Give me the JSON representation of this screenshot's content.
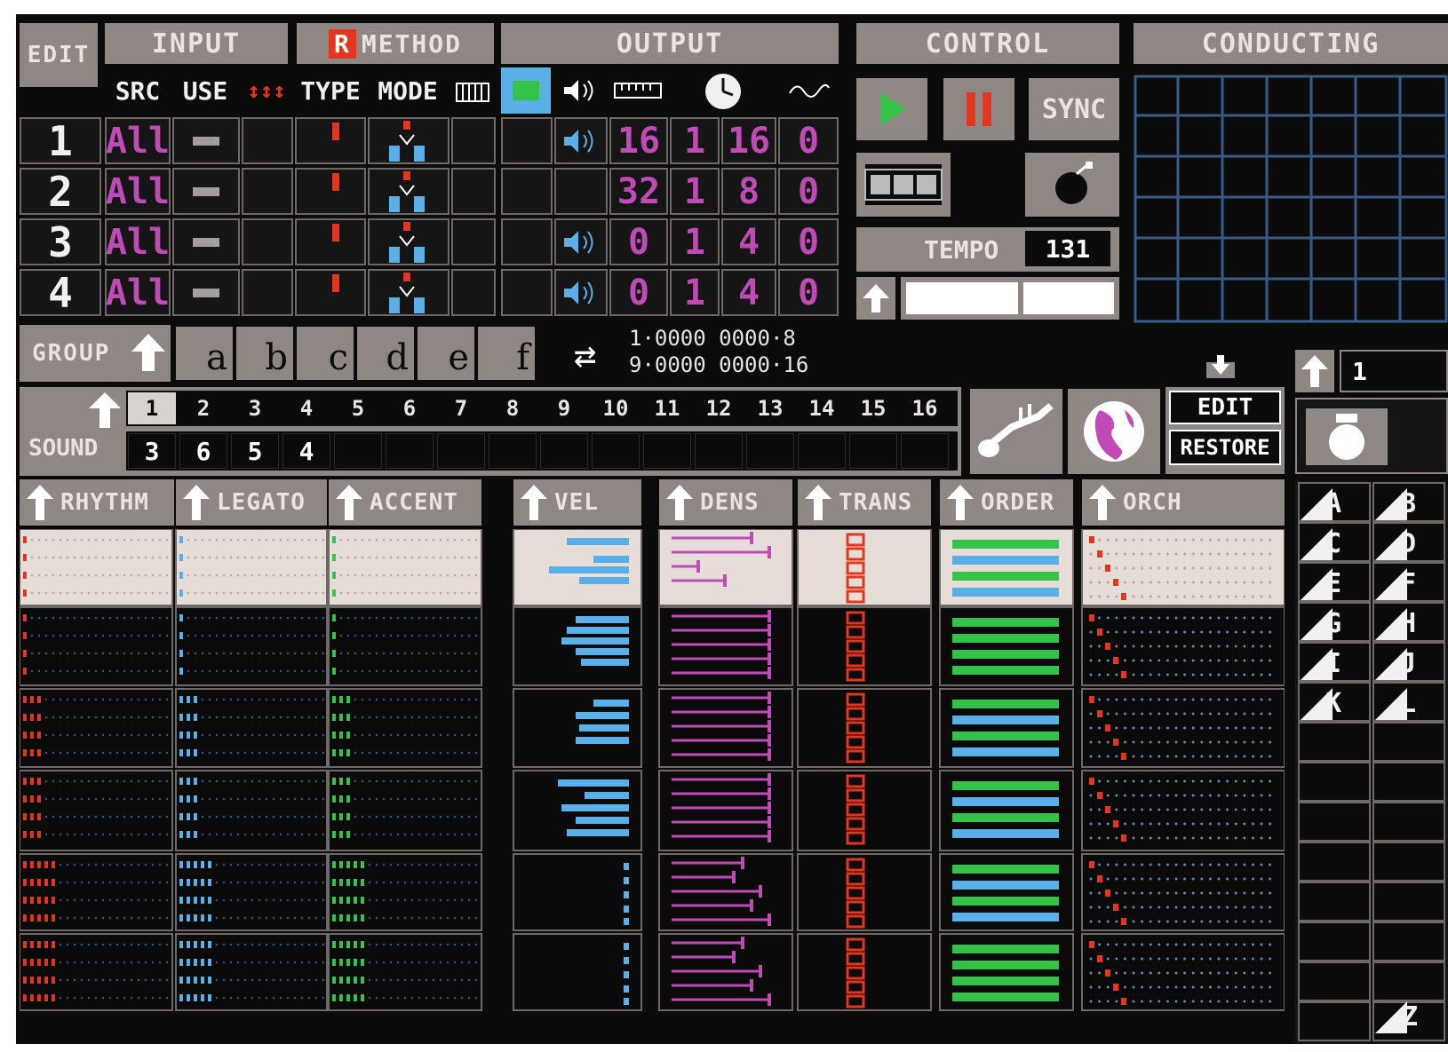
{
  "header": {
    "edit": "EDIT",
    "input": "INPUT",
    "method_badge": "R",
    "method": "METHOD",
    "output": "OUTPUT",
    "control": "CONTROL",
    "conducting": "CONDUCTING"
  },
  "columns": {
    "src": "SRC",
    "use": "USE",
    "type": "TYPE",
    "mode": "MODE"
  },
  "tracks": [
    {
      "num": "1",
      "src": "All",
      "o1": "16",
      "o2": "1",
      "o3": "16",
      "o4": "0"
    },
    {
      "num": "2",
      "src": "All",
      "o1": "32",
      "o2": "1",
      "o3": "8",
      "o4": "0"
    },
    {
      "num": "3",
      "src": "All",
      "o1": "0",
      "o2": "1",
      "o3": "4",
      "o4": "0"
    },
    {
      "num": "4",
      "src": "All",
      "o1": "0",
      "o2": "1",
      "o3": "4",
      "o4": "0"
    }
  ],
  "control": {
    "sync": "SYNC",
    "tempo_label": "TEMPO",
    "tempo_value": "131"
  },
  "group": {
    "label": "GROUP",
    "letters": [
      "a",
      "b",
      "c",
      "d",
      "e",
      "f"
    ],
    "code_line1": "1·0000 0000·8",
    "code_line2": "9·0000 0000·16"
  },
  "sound": {
    "label": "SOUND",
    "channels": [
      "1",
      "2",
      "3",
      "4",
      "5",
      "6",
      "7",
      "8",
      "9",
      "10",
      "11",
      "12",
      "13",
      "14",
      "15",
      "16"
    ],
    "assignments": [
      "3",
      "6",
      "5",
      "4"
    ],
    "edit": "EDIT",
    "restore": "RESTORE",
    "page_value": "1"
  },
  "lanes": {
    "rhythm": "RHYTHM",
    "legato": "LEGATO",
    "accent": "ACCENT",
    "vel": "VEL",
    "dens": "DENS",
    "trans": "TRANS",
    "order": "ORDER",
    "orch": "ORCH"
  },
  "letters_panel": [
    "A",
    "B",
    "C",
    "D",
    "E",
    "F",
    "G",
    "H",
    "I",
    "J",
    "K",
    "L"
  ],
  "letters_last": "Z",
  "colors": {
    "panel": "#8f8784",
    "magenta": "#c14bb6",
    "blue": "#5ab0e6",
    "green": "#35c24a",
    "red": "#e2361f",
    "grid": "#3a5a86"
  }
}
